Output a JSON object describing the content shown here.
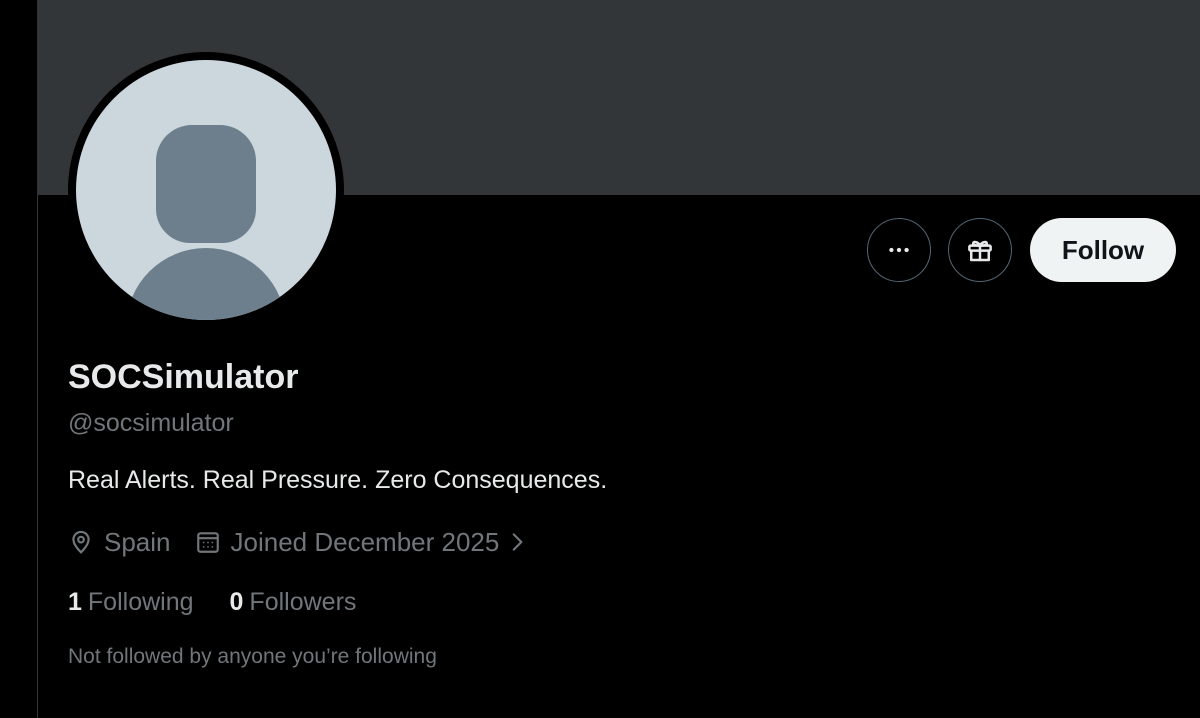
{
  "profile": {
    "display_name": "SOCSimulator",
    "handle": "@socsimulator",
    "bio": "Real Alerts. Real Pressure. Zero Consequences.",
    "location": "Spain",
    "joined": "Joined December 2025",
    "following_count": "1",
    "following_label": "Following",
    "followers_count": "0",
    "followers_label": "Followers",
    "mutuals_note": "Not followed by anyone you’re following"
  },
  "actions": {
    "more_icon": "more-horizontal-icon",
    "gift_icon": "gift-icon",
    "follow_label": "Follow"
  },
  "icons": {
    "location": "location-pin-icon",
    "calendar": "calendar-icon",
    "chevron": "chevron-right-icon"
  },
  "colors": {
    "background": "#000000",
    "banner": "#333639",
    "primary_text": "#e7e9ea",
    "secondary_text": "#71767b",
    "follow_button_bg": "#eff3f4"
  }
}
